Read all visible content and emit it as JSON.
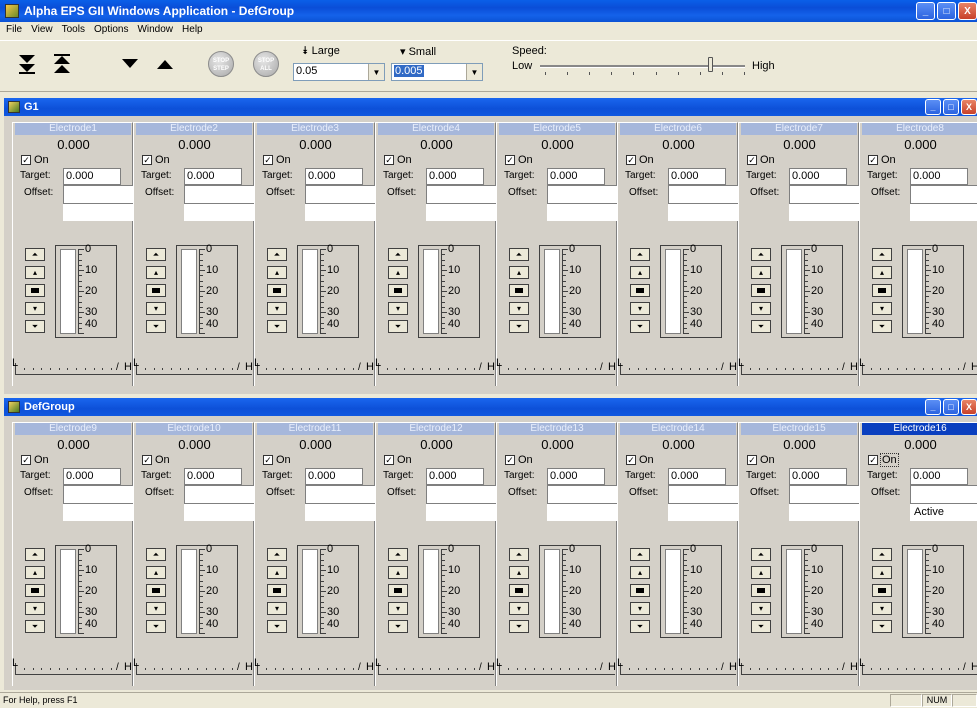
{
  "window": {
    "title": "Alpha EPS GII Windows Application - DefGroup",
    "min": "_",
    "max": "□",
    "close": "X"
  },
  "menu": [
    "File",
    "View",
    "Tools",
    "Options",
    "Window",
    "Help"
  ],
  "toolbar": {
    "stop_label": "STOP STEP",
    "stop_all_label": "STOP ALL",
    "large_label": "Large",
    "large_icon": "double-down-arrow",
    "large_value": "0.05",
    "small_label": "Small",
    "small_icon": "down-arrow",
    "small_value": "0.005",
    "speed_label": "Speed:",
    "speed_low": "Low",
    "speed_high": "High",
    "speed_level_percent": 83
  },
  "groups": [
    {
      "name": "G1",
      "electrodes": [
        {
          "name": "Electrode1",
          "value": "0.000",
          "on_label": "On",
          "target_label": "Target:",
          "target": "0.000",
          "offset_label": "Offset:",
          "status": "",
          "active": false
        },
        {
          "name": "Electrode2",
          "value": "0.000",
          "on_label": "On",
          "target_label": "Target:",
          "target": "0.000",
          "offset_label": "Offset:",
          "status": "",
          "active": false
        },
        {
          "name": "Electrode3",
          "value": "0.000",
          "on_label": "On",
          "target_label": "Target:",
          "target": "0.000",
          "offset_label": "Offset:",
          "status": "",
          "active": false
        },
        {
          "name": "Electrode4",
          "value": "0.000",
          "on_label": "On",
          "target_label": "Target:",
          "target": "0.000",
          "offset_label": "Offset:",
          "status": "",
          "active": false
        },
        {
          "name": "Electrode5",
          "value": "0.000",
          "on_label": "On",
          "target_label": "Target:",
          "target": "0.000",
          "offset_label": "Offset:",
          "status": "",
          "active": false
        },
        {
          "name": "Electrode6",
          "value": "0.000",
          "on_label": "On",
          "target_label": "Target:",
          "target": "0.000",
          "offset_label": "Offset:",
          "status": "",
          "active": false
        },
        {
          "name": "Electrode7",
          "value": "0.000",
          "on_label": "On",
          "target_label": "Target:",
          "target": "0.000",
          "offset_label": "Offset:",
          "status": "",
          "active": false
        },
        {
          "name": "Electrode8",
          "value": "0.000",
          "on_label": "On",
          "target_label": "Target:",
          "target": "0.000",
          "offset_label": "Offset:",
          "status": "",
          "active": false
        }
      ]
    },
    {
      "name": "DefGroup",
      "electrodes": [
        {
          "name": "Electrode9",
          "value": "0.000",
          "on_label": "On",
          "target_label": "Target:",
          "target": "0.000",
          "offset_label": "Offset:",
          "status": "",
          "active": false
        },
        {
          "name": "Electrode10",
          "value": "0.000",
          "on_label": "On",
          "target_label": "Target:",
          "target": "0.000",
          "offset_label": "Offset:",
          "status": "",
          "active": false
        },
        {
          "name": "Electrode11",
          "value": "0.000",
          "on_label": "On",
          "target_label": "Target:",
          "target": "0.000",
          "offset_label": "Offset:",
          "status": "",
          "active": false
        },
        {
          "name": "Electrode12",
          "value": "0.000",
          "on_label": "On",
          "target_label": "Target:",
          "target": "0.000",
          "offset_label": "Offset:",
          "status": "",
          "active": false
        },
        {
          "name": "Electrode13",
          "value": "0.000",
          "on_label": "On",
          "target_label": "Target:",
          "target": "0.000",
          "offset_label": "Offset:",
          "status": "",
          "active": false
        },
        {
          "name": "Electrode14",
          "value": "0.000",
          "on_label": "On",
          "target_label": "Target:",
          "target": "0.000",
          "offset_label": "Offset:",
          "status": "",
          "active": false
        },
        {
          "name": "Electrode15",
          "value": "0.000",
          "on_label": "On",
          "target_label": "Target:",
          "target": "0.000",
          "offset_label": "Offset:",
          "status": "",
          "active": false
        },
        {
          "name": "Electrode16",
          "value": "0.000",
          "on_label": "On",
          "target_label": "Target:",
          "target": "0.000",
          "offset_label": "Offset:",
          "status": "Active",
          "active": true
        }
      ]
    }
  ],
  "gauge": {
    "labels": [
      "0",
      "10",
      "20",
      "30",
      "40"
    ],
    "range": [
      0,
      40
    ]
  },
  "hscale": {
    "low": "L",
    "high": "H"
  },
  "statusbar": {
    "text": "For Help, press F1",
    "num": "NUM"
  },
  "colors": {
    "titlebar": "#0a4ed8",
    "panel_header": "#a6b7db",
    "panel_header_active": "#0a3fbf",
    "selection": "#316ac5"
  }
}
